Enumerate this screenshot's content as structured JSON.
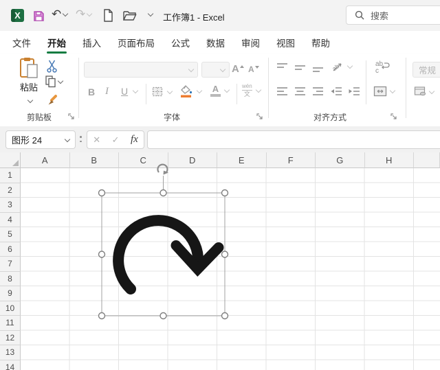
{
  "titlebar": {
    "title": "工作簿1 - Excel",
    "search": "搜索",
    "undo_glyph": "↶",
    "redo_glyph": "↷"
  },
  "tabs": {
    "active": "开始",
    "items": [
      "文件",
      "开始",
      "插入",
      "页面布局",
      "公式",
      "数据",
      "审阅",
      "视图",
      "帮助"
    ]
  },
  "ribbon": {
    "clipboard": {
      "label": "剪贴板",
      "paste": "粘贴"
    },
    "font": {
      "label": "字体",
      "bold": "B",
      "italic": "I",
      "underline": "U",
      "grow": "A",
      "shrink": "A",
      "color_glyph": "A",
      "phonetic_top": "wén",
      "phonetic_bottom": "文"
    },
    "alignment": {
      "label": "对齐方式",
      "orientation_glyph": "ab",
      "wrap_top": "ab",
      "wrap_bottom": "c"
    },
    "number": {
      "format": "常规"
    }
  },
  "formula_bar": {
    "name_box": "图形 24",
    "cancel": "✕",
    "enter": "✓",
    "fx": "fx"
  },
  "grid": {
    "columns": [
      "A",
      "B",
      "C",
      "D",
      "E",
      "F",
      "G",
      "H"
    ],
    "rows": [
      "1",
      "2",
      "3",
      "4",
      "5",
      "6",
      "7",
      "8",
      "9",
      "10",
      "11",
      "12",
      "13",
      "14"
    ]
  },
  "shape": {
    "kind": "circular-arrow",
    "stroke": "#161616"
  },
  "colors": {
    "accent_green": "#107C41",
    "shape_black": "#161616",
    "fill_orange": "#ED7D31",
    "save_magenta": "#C55BC5",
    "clipboard_orange": "#C9802F",
    "scissors_blue": "#4779B5",
    "titlebar_bg": "#F3F3F3"
  }
}
